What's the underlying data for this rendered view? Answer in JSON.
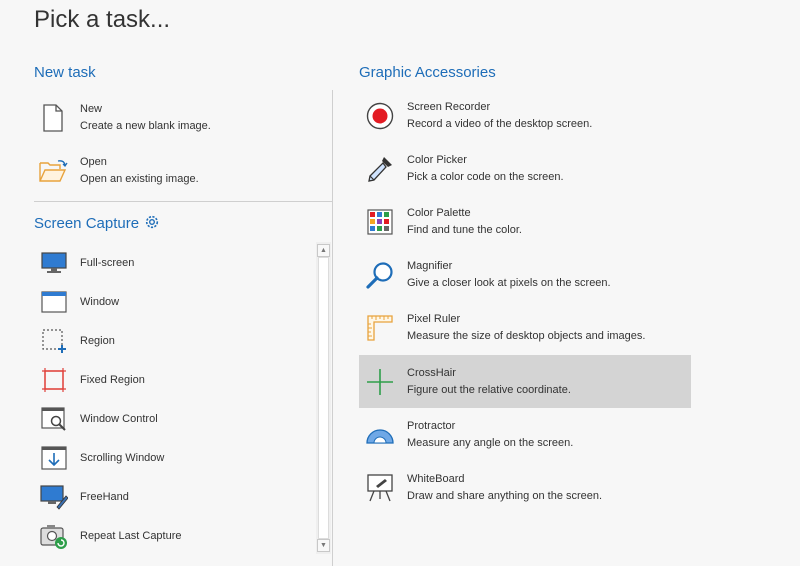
{
  "title": "Pick a task...",
  "new_task": {
    "heading": "New task",
    "items": [
      {
        "name": "New",
        "desc": "Create a new blank image.",
        "icon": "blank-document-icon"
      },
      {
        "name": "Open",
        "desc": "Open an existing image.",
        "icon": "open-folder-icon"
      }
    ]
  },
  "screen_capture": {
    "heading": "Screen Capture",
    "settings_icon": "gear-icon",
    "items": [
      {
        "name": "Full-screen",
        "icon": "monitor-icon"
      },
      {
        "name": "Window",
        "icon": "window-icon"
      },
      {
        "name": "Region",
        "icon": "region-icon"
      },
      {
        "name": "Fixed Region",
        "icon": "fixed-region-icon"
      },
      {
        "name": "Window Control",
        "icon": "window-control-icon"
      },
      {
        "name": "Scrolling Window",
        "icon": "scrolling-window-icon"
      },
      {
        "name": "FreeHand",
        "icon": "freehand-icon"
      },
      {
        "name": "Repeat Last Capture",
        "icon": "repeat-capture-icon"
      }
    ]
  },
  "graphic_accessories": {
    "heading": "Graphic Accessories",
    "selected": "CrossHair",
    "items": [
      {
        "name": "Screen Recorder",
        "desc": "Record a video of the desktop screen.",
        "icon": "record-icon"
      },
      {
        "name": "Color Picker",
        "desc": "Pick a color code on the screen.",
        "icon": "eyedropper-icon"
      },
      {
        "name": "Color Palette",
        "desc": "Find and tune the color.",
        "icon": "palette-grid-icon"
      },
      {
        "name": "Magnifier",
        "desc": "Give a closer look at pixels on the screen.",
        "icon": "magnifier-icon"
      },
      {
        "name": "Pixel Ruler",
        "desc": "Measure the size of desktop objects and images.",
        "icon": "ruler-icon"
      },
      {
        "name": "CrossHair",
        "desc": "Figure out the relative coordinate.",
        "icon": "crosshair-icon"
      },
      {
        "name": "Protractor",
        "desc": "Measure any angle on the screen.",
        "icon": "protractor-icon"
      },
      {
        "name": "WhiteBoard",
        "desc": "Draw and share anything on the screen.",
        "icon": "whiteboard-icon"
      }
    ]
  },
  "colors": {
    "accent": "#1e6db8",
    "selected_bg": "#d4d4d4",
    "record_red": "#e31b23",
    "crosshair_green": "#2e9e4a"
  }
}
